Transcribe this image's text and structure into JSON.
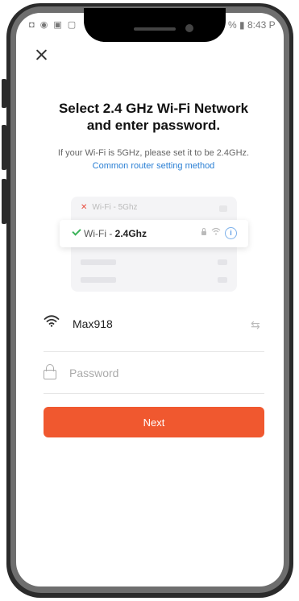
{
  "status_bar": {
    "left_icons": "◘ ◉ ▣ ▢",
    "right": "% ▮ 8:43 P"
  },
  "header": {
    "title_line1": "Select 2.4 GHz Wi-Fi Network",
    "title_line2": "and enter password."
  },
  "info": {
    "subtitle": "If your Wi-Fi is 5GHz, please set it to be 2.4GHz.",
    "link": "Common router setting method"
  },
  "illustration": {
    "row_5ghz": "Wi-Fi - 5Ghz",
    "row_24_prefix": "Wi-Fi - ",
    "row_24_band": "2.4Ghz"
  },
  "form": {
    "ssid": "Max918",
    "password_placeholder": "Password",
    "next_label": "Next"
  },
  "colors": {
    "accent": "#f0582f",
    "link": "#2a7fd4",
    "check": "#3bb35a",
    "cross": "#e84b3c"
  }
}
